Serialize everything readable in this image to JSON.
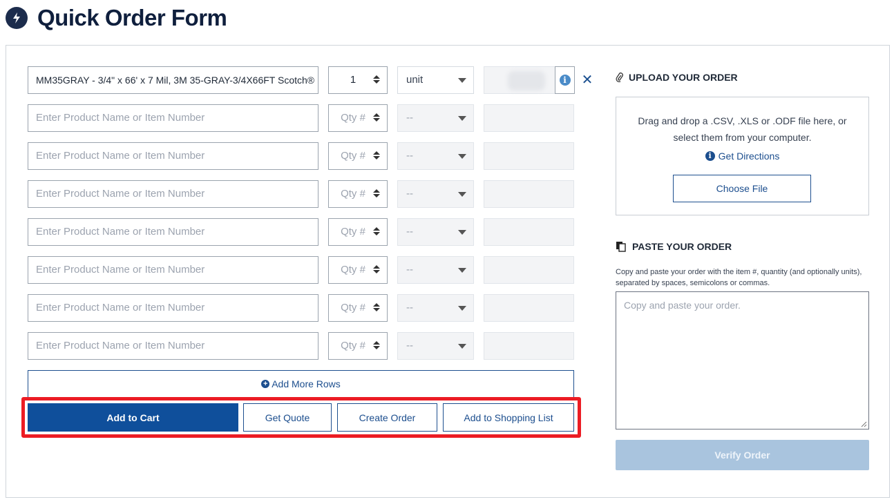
{
  "page": {
    "title": "Quick Order Form"
  },
  "order_rows": [
    {
      "product": "MM35GRAY - 3/4\" x 66' x 7 Mil, 3M 35-GRAY-3/4X66FT Scotch®",
      "product_placeholder": "Enter Product Name or Item Number",
      "qty": "1",
      "unit": "unit",
      "filled": true
    },
    {
      "product": "",
      "product_placeholder": "Enter Product Name or Item Number",
      "qty": "Qty #",
      "unit": "--",
      "filled": false
    },
    {
      "product": "",
      "product_placeholder": "Enter Product Name or Item Number",
      "qty": "Qty #",
      "unit": "--",
      "filled": false
    },
    {
      "product": "",
      "product_placeholder": "Enter Product Name or Item Number",
      "qty": "Qty #",
      "unit": "--",
      "filled": false
    },
    {
      "product": "",
      "product_placeholder": "Enter Product Name or Item Number",
      "qty": "Qty #",
      "unit": "--",
      "filled": false
    },
    {
      "product": "",
      "product_placeholder": "Enter Product Name or Item Number",
      "qty": "Qty #",
      "unit": "--",
      "filled": false
    },
    {
      "product": "",
      "product_placeholder": "Enter Product Name or Item Number",
      "qty": "Qty #",
      "unit": "--",
      "filled": false
    },
    {
      "product": "",
      "product_placeholder": "Enter Product Name or Item Number",
      "qty": "Qty #",
      "unit": "--",
      "filled": false
    }
  ],
  "actions": {
    "add_rows": "Add More Rows",
    "add_to_cart": "Add to Cart",
    "get_quote": "Get Quote",
    "create_order": "Create Order",
    "add_to_list": "Add to Shopping List"
  },
  "upload": {
    "title": "UPLOAD YOUR ORDER",
    "drop_text": "Drag and drop a .CSV, .XLS or .ODF file here, or select them from your computer.",
    "directions": "Get Directions",
    "choose_file": "Choose File"
  },
  "paste": {
    "title": "PASTE YOUR ORDER",
    "help": "Copy and paste your order with the item #, quantity (and optionally units), separated by spaces, semicolons or commas.",
    "placeholder": "Copy and paste your order.",
    "verify": "Verify Order"
  },
  "colors": {
    "primary": "#0f4f9b",
    "highlight": "#ec1c24",
    "disabled": "#a9c4de",
    "heading": "#0f1f3d"
  },
  "icons": [
    "bolt-icon",
    "info-icon",
    "close-icon",
    "plus-circle-icon",
    "paperclip-icon",
    "documents-icon",
    "spinner-arrows-icon",
    "chevron-down-icon"
  ]
}
